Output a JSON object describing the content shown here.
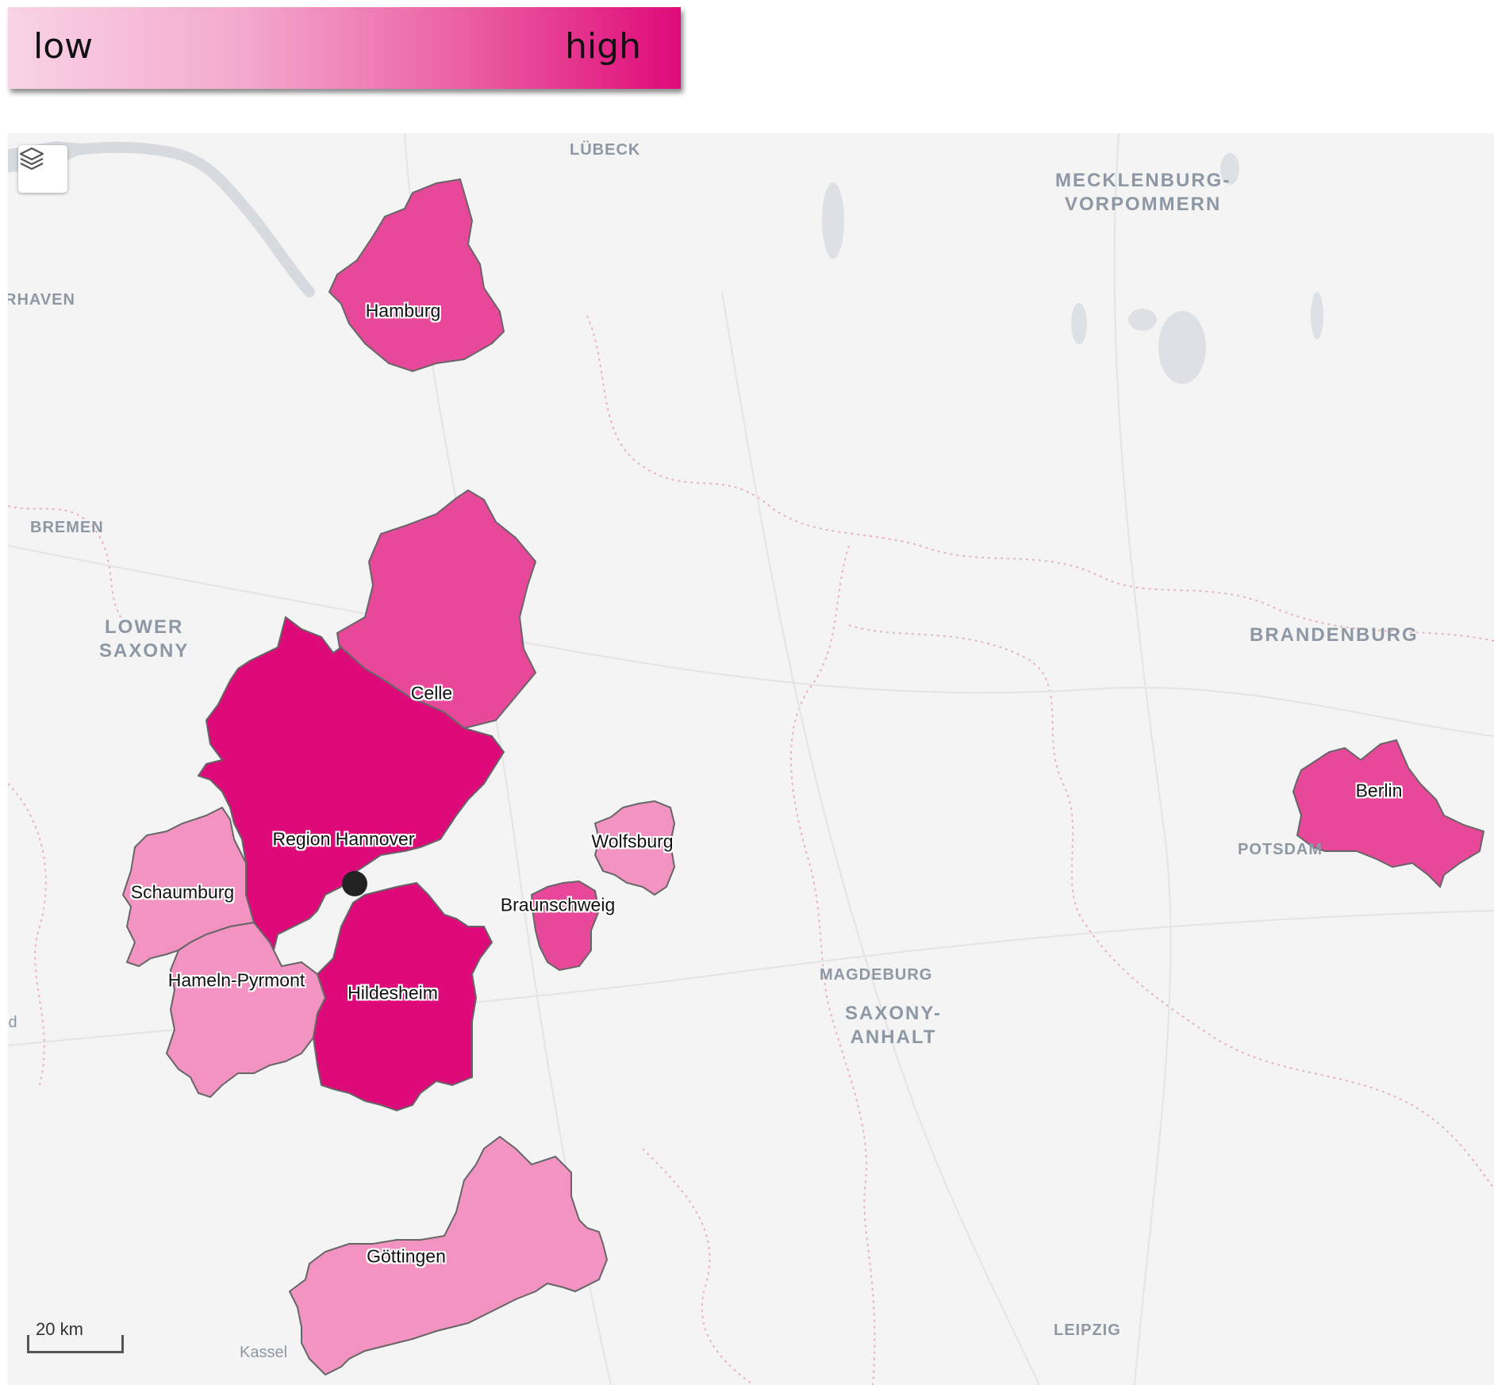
{
  "legend": {
    "low_label": "low",
    "high_label": "high",
    "color_low": "#f9d3e6",
    "color_high": "#df0a79"
  },
  "map": {
    "layers_button_icon": "layers-icon",
    "scale_label": "20 km",
    "places": {
      "lubeck": "LÜBECK",
      "mecklenburg": "MECKLENBURG-\nVORPOMMERN",
      "bremerhaven": "RHAVEN",
      "bremen": "BREMEN",
      "lower_saxony": "LOWER\nSAXONY",
      "brandenburg": "BRANDENBURG",
      "potsdam": "POTSDAM",
      "magdeburg": "MAGDEBURG",
      "saxony_anhalt": "SAXONY-\nANHALT",
      "leipzig": "LEIPZIG",
      "kassel": "Kassel",
      "partial_left": "ld"
    },
    "regions": [
      {
        "name": "Hamburg",
        "level": "medium-high",
        "color": "#e8489a"
      },
      {
        "name": "Celle",
        "level": "medium-high",
        "color": "#e8489a"
      },
      {
        "name": "Region Hannover",
        "level": "high",
        "color": "#df0a79"
      },
      {
        "name": "Schaumburg",
        "level": "low",
        "color": "#f293c2"
      },
      {
        "name": "Hameln-Pyrmont",
        "level": "low",
        "color": "#f293c2"
      },
      {
        "name": "Hildesheim",
        "level": "high",
        "color": "#df0a79"
      },
      {
        "name": "Wolfsburg",
        "level": "low",
        "color": "#f293c2"
      },
      {
        "name": "Braunschweig",
        "level": "medium-high",
        "color": "#e8489a"
      },
      {
        "name": "Göttingen",
        "level": "low",
        "color": "#f293c2"
      },
      {
        "name": "Berlin",
        "level": "medium-high",
        "color": "#e8489a"
      }
    ]
  }
}
